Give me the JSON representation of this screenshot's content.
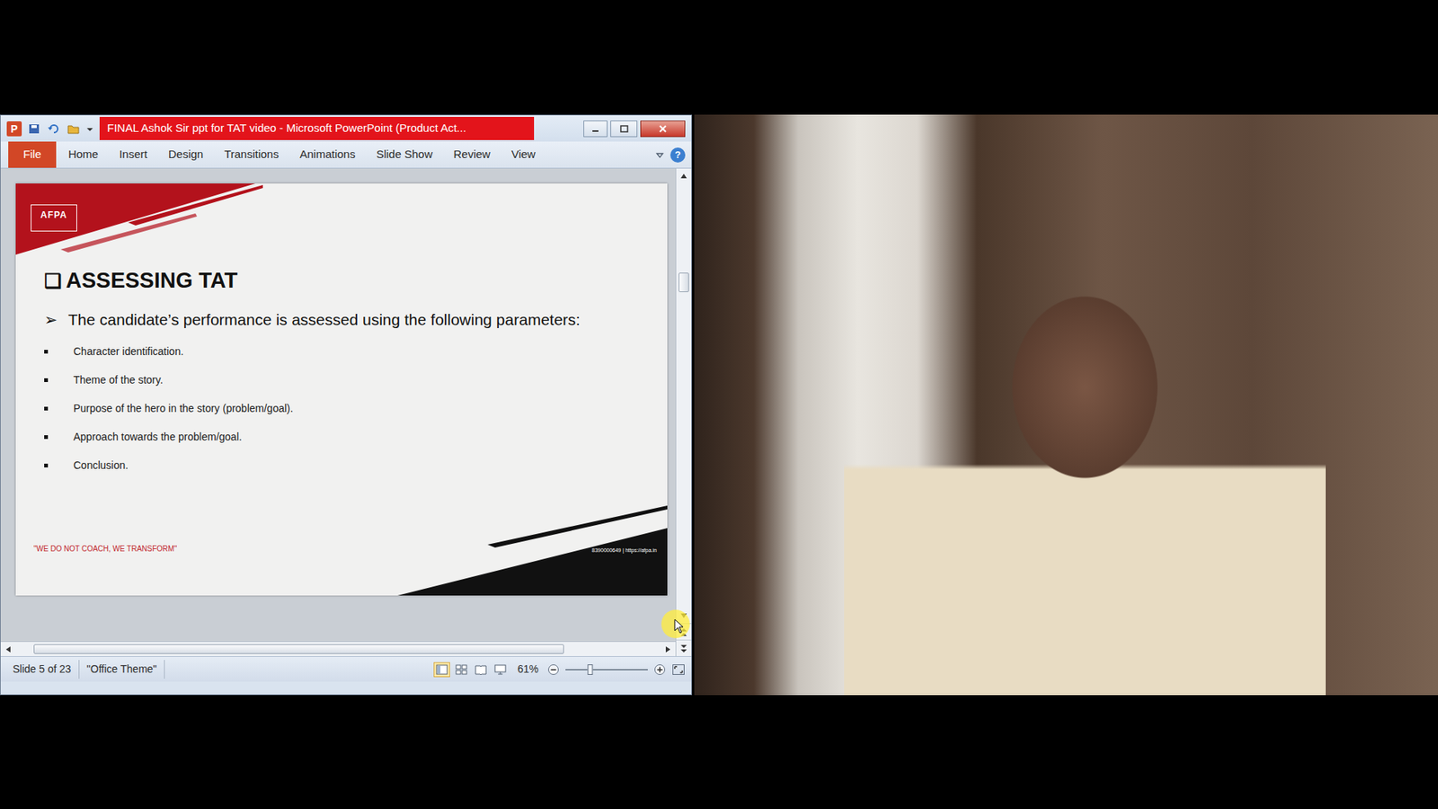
{
  "window": {
    "app_icon": "P",
    "title": "FINAL Ashok Sir ppt for TAT video  -  Microsoft PowerPoint (Product Act..."
  },
  "ribbon": {
    "tabs": [
      {
        "label": "File",
        "kind": "file"
      },
      {
        "label": "Home",
        "kind": "tab"
      },
      {
        "label": "Insert",
        "kind": "tab"
      },
      {
        "label": "Design",
        "kind": "tab"
      },
      {
        "label": "Transitions",
        "kind": "tab"
      },
      {
        "label": "Animations",
        "kind": "tab"
      },
      {
        "label": "Slide Show",
        "kind": "tab"
      },
      {
        "label": "Review",
        "kind": "tab"
      },
      {
        "label": "View",
        "kind": "tab"
      }
    ],
    "help": "?"
  },
  "slide": {
    "logo": "AFPA",
    "heading_marker": "❑",
    "heading": "ASSESSING TAT",
    "intro_marker": "➢",
    "intro": "The candidate’s performance is assessed using the following parameters:",
    "bullets": [
      "Character identification.",
      "Theme of the story.",
      "Purpose of the hero in the story (problem/goal).",
      "Approach towards the problem/goal.",
      "Conclusion."
    ],
    "footer_quote": "\"WE DO NOT COACH, WE TRANSFORM\"",
    "footer_contact": "8390000649 | https://afpa.in"
  },
  "vertical_scroll": {
    "level": 0.22
  },
  "horizontal_scroll": {
    "level": 0.85
  },
  "status_bar": {
    "slide_info": "Slide 5 of 23",
    "theme": "\"Office Theme\"",
    "views": [
      {
        "selected": true
      },
      {
        "selected": false
      },
      {
        "selected": false
      },
      {
        "selected": false
      }
    ],
    "zoom": "61%",
    "zoom_level": 0.3
  }
}
